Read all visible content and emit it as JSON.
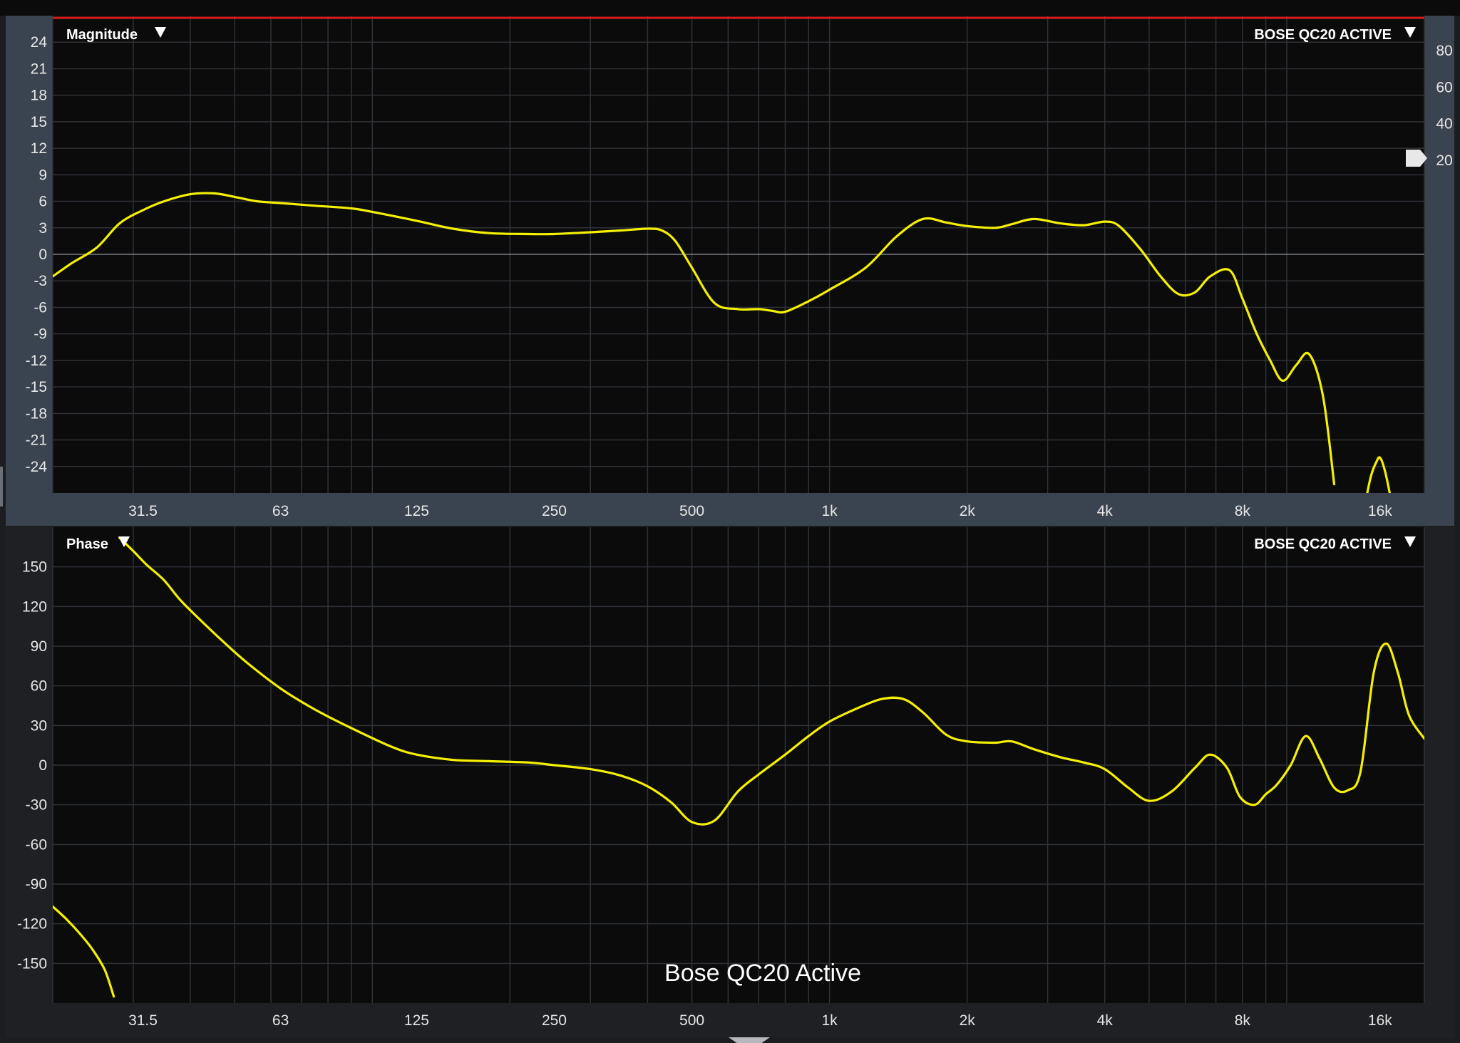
{
  "colors": {
    "curve": "#f5f000",
    "reference_line": "#d81c1c",
    "plot_background": "#0b0b0c",
    "panel_background": "#394450"
  },
  "magnitude_panel": {
    "title": "Magnitude",
    "title_icon": "dropdown-triangle-icon",
    "trace_name": "BOSE QC20 ACTIVE",
    "trace_icon": "dropdown-triangle-icon",
    "right_marker_icon": "level-marker-icon",
    "y_ticks": [
      "24",
      "21",
      "18",
      "15",
      "12",
      "9",
      "6",
      "3",
      "0",
      "-3",
      "-6",
      "-9",
      "-12",
      "-15",
      "-18",
      "-21",
      "-24"
    ],
    "right_ticks": [
      "80",
      "60",
      "40",
      "20"
    ],
    "x_ticks": [
      "31.5",
      "63",
      "125",
      "250",
      "500",
      "1k",
      "2k",
      "4k",
      "8k",
      "16k"
    ]
  },
  "phase_panel": {
    "title": "Phase",
    "title_icon": "dropdown-triangle-icon",
    "trace_name": "BOSE QC20 ACTIVE",
    "trace_icon": "dropdown-triangle-icon",
    "caption": "Bose QC20 Active",
    "y_ticks": [
      "150",
      "120",
      "90",
      "60",
      "30",
      "0",
      "-30",
      "-60",
      "-90",
      "-120",
      "-150"
    ],
    "x_ticks": [
      "31.5",
      "63",
      "125",
      "250",
      "500",
      "1k",
      "2k",
      "4k",
      "8k",
      "16k"
    ]
  },
  "chart_data": [
    {
      "type": "line",
      "title": "Magnitude",
      "x_scale": "log",
      "xlim": [
        20,
        20000
      ],
      "ylim": [
        -27,
        27
      ],
      "y_secondary_ticks": [
        80,
        60,
        40,
        20
      ],
      "grid": true,
      "series": [
        {
          "name": "BOSE QC20 ACTIVE",
          "x": [
            20,
            22,
            25,
            28,
            31.5,
            35,
            40,
            45,
            50,
            56,
            63,
            75,
            90,
            100,
            125,
            150,
            180,
            220,
            250,
            300,
            350,
            400,
            430,
            460,
            500,
            560,
            630,
            700,
            750,
            800,
            900,
            1000,
            1200,
            1400,
            1600,
            1800,
            2000,
            2300,
            2500,
            2800,
            3200,
            3600,
            4000,
            4300,
            4800,
            5300,
            5800,
            6300,
            6800,
            7500,
            8000,
            8600,
            9200,
            9800,
            10500,
            11200,
            12000,
            12700
          ],
          "y": [
            -2.5,
            -1,
            0.8,
            3.5,
            5,
            6,
            6.8,
            6.9,
            6.5,
            6,
            5.8,
            5.5,
            5.2,
            4.8,
            3.8,
            2.9,
            2.4,
            2.3,
            2.3,
            2.5,
            2.7,
            2.9,
            2.7,
            1.5,
            -1.5,
            -5.5,
            -6.2,
            -6.2,
            -6.4,
            -6.5,
            -5.3,
            -4,
            -1.5,
            2,
            4,
            3.6,
            3.2,
            3,
            3.4,
            4,
            3.5,
            3.3,
            3.7,
            3.2,
            0.5,
            -2.5,
            -4.5,
            -4.3,
            -2.5,
            -1.8,
            -5,
            -9,
            -12,
            -14.3,
            -12.5,
            -11.3,
            -16,
            -26
          ]
        },
        {
          "name": "BOSE QC20 ACTIVE (upper band)",
          "x": [
            15000,
            15300,
            15700,
            16000,
            16400,
            16800
          ],
          "y": [
            -27,
            -25,
            -23.5,
            -23,
            -24.5,
            -27
          ]
        }
      ]
    },
    {
      "type": "line",
      "title": "Phase",
      "x_scale": "log",
      "xlim": [
        20,
        20000
      ],
      "ylim": [
        -180,
        180
      ],
      "grid": true,
      "series": [
        {
          "name": "BOSE QC20 ACTIVE",
          "x": [
            20,
            21.5,
            23,
            24.5,
            26,
            27.2
          ],
          "y": [
            -107,
            -117,
            -128,
            -140,
            -155,
            -175
          ]
        },
        {
          "name": "BOSE QC20 ACTIVE (wrapped)",
          "x": [
            28,
            30,
            32,
            35,
            38,
            42,
            47,
            53,
            63,
            75,
            90,
            110,
            125,
            150,
            180,
            220,
            250,
            300,
            350,
            400,
            450,
            500,
            560,
            630,
            700,
            800,
            900,
            1000,
            1150,
            1300,
            1450,
            1600,
            1800,
            2000,
            2300,
            2500,
            2800,
            3200,
            3600,
            4000,
            4500,
            5000,
            5600,
            6300,
            6800,
            7400,
            7900,
            8500,
            9000,
            9500,
            10200,
            11000,
            11800,
            12700,
            13600,
            14500,
            15500,
            16500,
            17500,
            18500,
            20000
          ],
          "y": [
            172,
            162,
            152,
            140,
            125,
            110,
            94,
            78,
            58,
            42,
            28,
            14,
            8,
            4,
            3,
            2,
            0,
            -3,
            -8,
            -16,
            -28,
            -43,
            -42,
            -20,
            -7,
            8,
            22,
            33,
            43,
            50,
            50,
            40,
            23,
            18,
            17,
            18,
            12,
            6,
            2,
            -3,
            -17,
            -27,
            -20,
            -2,
            8,
            -2,
            -24,
            -30,
            -22,
            -15,
            0,
            22,
            5,
            -17,
            -19,
            -5,
            70,
            92,
            70,
            38,
            20
          ]
        }
      ]
    }
  ]
}
